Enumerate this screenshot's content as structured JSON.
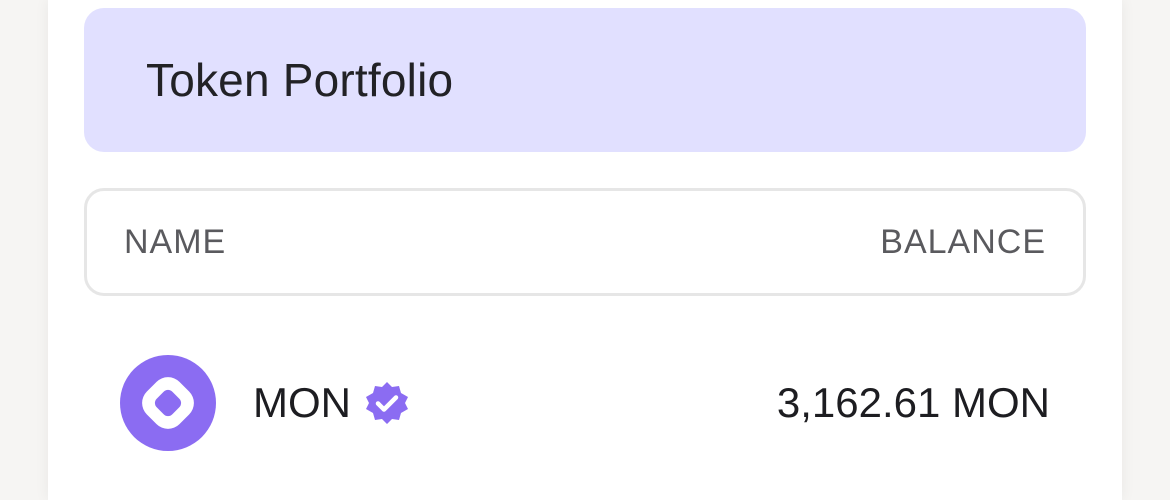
{
  "header": {
    "title": "Token Portfolio"
  },
  "table": {
    "columns": [
      "NAME",
      "BALANCE"
    ],
    "rows": [
      {
        "icon": "mon-token-logo",
        "name": "MON",
        "verified_icon": "verified-badge-icon",
        "balance": "3,162.61 MON"
      }
    ]
  },
  "colors": {
    "accent": "#8b6cf2",
    "header_bg": "#e1e0ff"
  }
}
